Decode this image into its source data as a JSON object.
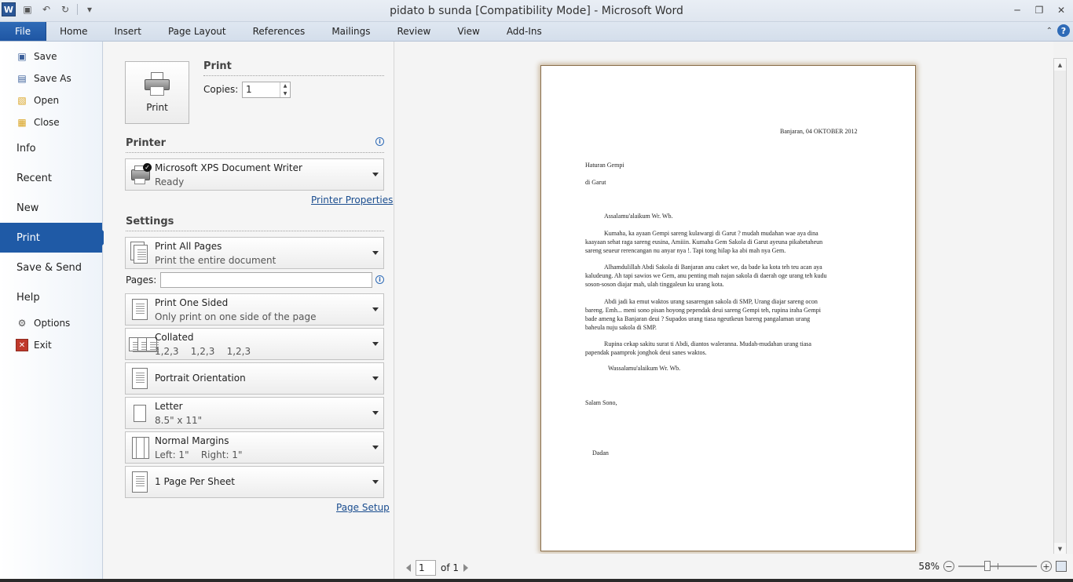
{
  "window": {
    "title": "pidato b sunda [Compatibility Mode] - Microsoft Word",
    "logo": "W"
  },
  "ribbon": {
    "tabs": [
      "File",
      "Home",
      "Insert",
      "Page Layout",
      "References",
      "Mailings",
      "Review",
      "View",
      "Add-Ins"
    ]
  },
  "nav": {
    "save": "Save",
    "save_as": "Save As",
    "open": "Open",
    "close": "Close",
    "info": "Info",
    "recent": "Recent",
    "new": "New",
    "print": "Print",
    "save_send": "Save & Send",
    "help": "Help",
    "options": "Options",
    "exit": "Exit"
  },
  "print": {
    "button_label": "Print",
    "section_title": "Print",
    "copies_label": "Copies:",
    "copies_value": "1"
  },
  "printer": {
    "section_title": "Printer",
    "name": "Microsoft XPS Document Writer",
    "status": "Ready",
    "properties_link": "Printer Properties"
  },
  "settings": {
    "section_title": "Settings",
    "range_title": "Print All Pages",
    "range_desc": "Print the entire document",
    "pages_label": "Pages:",
    "pages_value": "",
    "sides_title": "Print One Sided",
    "sides_desc": "Only print on one side of the page",
    "collate_title": "Collated",
    "collate_desc": "1,2,3    1,2,3    1,2,3",
    "orientation": "Portrait Orientation",
    "paper_title": "Letter",
    "paper_desc": "8.5\" x 11\"",
    "margins_title": "Normal Margins",
    "margins_desc": "Left: 1\"    Right: 1\"",
    "per_sheet": "1 Page Per Sheet",
    "page_setup_link": "Page Setup"
  },
  "document": {
    "date": "Banjaran, 04 OKTOBER 2012",
    "to": "Haturan  Gempi",
    "place": "di Garut",
    "greeting": "Assalamu'alaikum Wr. Wb.",
    "p1_l1": "Kumaha, ka ayaan Gempi sareng kulawargi di Garut ? mudah mudahan wae aya dina",
    "p1_l2": "kaayaan sehat raga sareng eusina, Amiiin. Kumaha Gem Sakola di Garut ayeuna pikabetaheun",
    "p1_l3": "sareng seueur rerencangan nu anyar nya !. Tapi tong hilap ka abi mah nya Gem.",
    "p2_l1": "Alhamdulillah Abdi Sakola di Banjaran anu caket we, da bade ka kota teh teu acan aya",
    "p2_l2": "kaludeung. Ah tapi sawios we Gem, anu penting mah najan sakola di daerah oge urang teh kudu",
    "p2_l3": "soson-soson diajar mah, ulah tinggaleun ku urang kota.",
    "p3_l1": "Abdi jadi ka emut waktos urang sasarengan sakola di SMP, Urang diajar sareng ocon",
    "p3_l2": "bareng. Emh... meni sono pisan hoyong pependak deui sareng Gempi teh, rupina iraha Gempi",
    "p3_l3": "bade ameng ka Banjaran deui ? Supados urang tiasa ngeutkeun bareng pangalaman urang",
    "p3_l4": "baheula nuju sakola di SMP.",
    "p4_l1": "Rupina cekap sakitu surat ti Abdi, diantos waleranna. Mudah-mudahan urang tiasa",
    "p4_l2": "papendak paamprok jonghok deui sanes waktos.",
    "closing": "Wassalamu'alaikum Wr. Wb.",
    "salam": "Salam Sono,",
    "signature": "Dadan"
  },
  "preview_nav": {
    "page_value": "1",
    "of_label": "of 1",
    "zoom": "58%",
    "zoom_fraction": 0.58
  },
  "icons": {
    "save": "floppy-disk-icon",
    "save_as": "save-as-icon",
    "open": "folder-open-icon",
    "close": "folder-close-icon",
    "options": "options-icon",
    "exit": "exit-icon"
  },
  "colors": {
    "accent": "#1f5aa6",
    "link": "#1a4d8f",
    "exit_red": "#c0392b"
  }
}
